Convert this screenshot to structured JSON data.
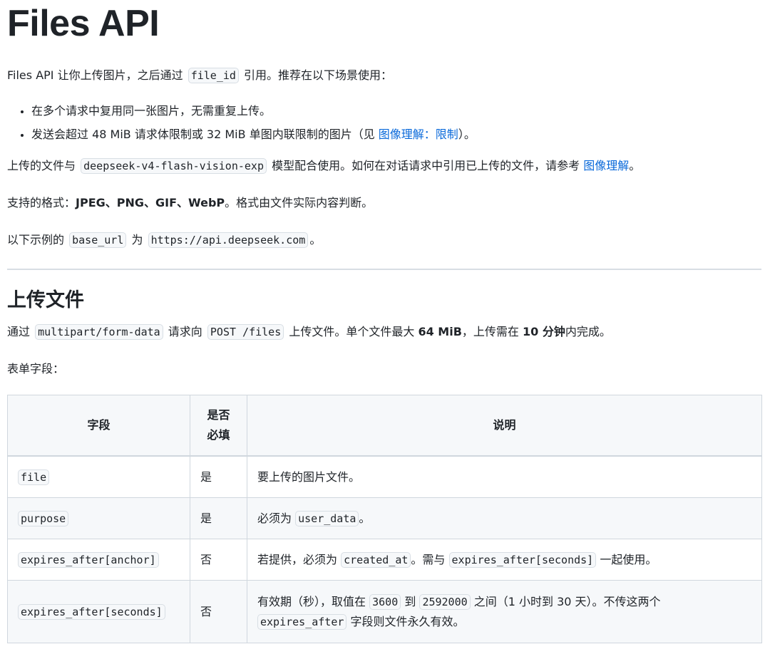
{
  "doc": {
    "title": "Files API",
    "intro": {
      "pre": "Files API 让你上传图片，之后通过",
      "code": "file_id",
      "post": "引用。推荐在以下场景使用："
    },
    "bullets": [
      {
        "text": "在多个请求中复用同一张图片，无需重复上传。"
      },
      {
        "pre": "发送会超过 48 MiB 请求体限制或 32 MiB 单图内联限制的图片（见",
        "link": "图像理解：限制",
        "post": "）。"
      }
    ],
    "model_para": {
      "pre": "上传的文件与",
      "code": "deepseek-v4-flash-vision-exp",
      "mid": "模型配合使用。如何在对话请求中引用已上传的文件，请参考",
      "link": "图像理解",
      "post": "。"
    },
    "formats_para": {
      "pre": "支持的格式：",
      "bold": "JPEG、PNG、GIF、WebP",
      "post": "。格式由文件实际内容判断。"
    },
    "base_para": {
      "pre": "以下示例的",
      "code1": "base_url",
      "mid": "为",
      "code2": "https://api.deepseek.com",
      "post": "。"
    }
  },
  "upload": {
    "heading": "上传文件",
    "para": {
      "pre": "通过",
      "code1": "multipart/form-data",
      "mid1": "请求向",
      "code2": "POST /files",
      "mid2": "上传文件。单个文件最大",
      "bold1": "64 MiB",
      "mid3": "，上传需在",
      "bold2": "10 分钟",
      "post": "内完成。"
    },
    "fields_label": "表单字段："
  },
  "table": {
    "headers": {
      "field": "字段",
      "required_line1": "是否",
      "required_line2": "必填",
      "desc": "说明"
    },
    "rows": [
      {
        "field": "file",
        "required": "是",
        "desc_pre": "要上传的图片文件。"
      },
      {
        "field": "purpose",
        "required": "是",
        "desc_pre": "必须为",
        "desc_code1": "user_data",
        "desc_post": "。"
      },
      {
        "field": "expires_after[anchor]",
        "required": "否",
        "desc_pre": "若提供，必须为",
        "desc_code1": "created_at",
        "desc_mid": "。需与",
        "desc_code2": "expires_after[seconds]",
        "desc_post": "一起使用。"
      },
      {
        "field": "expires_after[seconds]",
        "required": "否",
        "desc_pre": "有效期（秒），取值在",
        "desc_code1": "3600",
        "desc_mid1": "到",
        "desc_code2": "2592000",
        "desc_mid2": "之间（1 小时到 30 天）。不传这两个",
        "desc_code3": "expires_after",
        "desc_post": "字段则文件永久有效。"
      }
    ]
  }
}
